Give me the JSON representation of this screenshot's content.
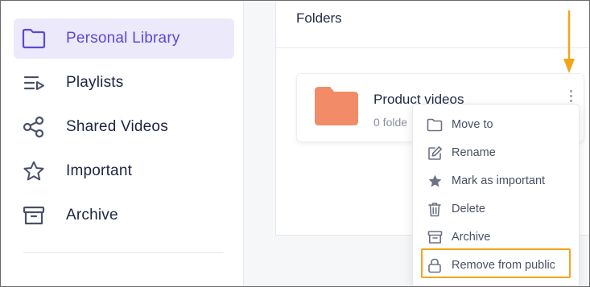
{
  "sidebar": {
    "items": [
      {
        "label": "Personal Library",
        "icon": "folder-icon",
        "active": true
      },
      {
        "label": "Playlists",
        "icon": "playlist-icon",
        "active": false
      },
      {
        "label": "Shared Videos",
        "icon": "share-icon",
        "active": false
      },
      {
        "label": "Important",
        "icon": "star-icon",
        "active": false
      },
      {
        "label": "Archive",
        "icon": "archive-icon",
        "active": false
      }
    ]
  },
  "main": {
    "section_title": "Folders",
    "folder": {
      "name": "Product videos",
      "count": "0 folde",
      "icon": "folder-icon",
      "color": "#f28c68"
    }
  },
  "menu": {
    "items": [
      {
        "label": "Move to",
        "icon": "folder-outline-icon"
      },
      {
        "label": "Rename",
        "icon": "edit-icon"
      },
      {
        "label": "Mark as important",
        "icon": "star-icon"
      },
      {
        "label": "Delete",
        "icon": "trash-icon"
      },
      {
        "label": "Archive",
        "icon": "archive-icon"
      },
      {
        "label": "Remove from public",
        "icon": "lock-icon"
      }
    ]
  },
  "colors": {
    "accent": "#5b49d6",
    "active_bg": "#ece9fb",
    "annotation": "#f2a516",
    "folder": "#f28c68"
  }
}
